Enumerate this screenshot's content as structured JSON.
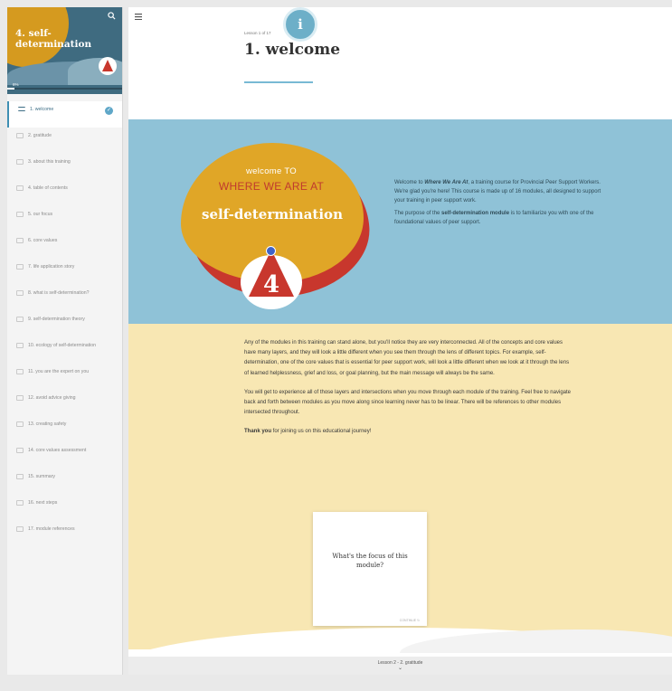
{
  "sidebar": {
    "course_title_line1": "4. self-",
    "course_title_line2": "determination",
    "progress_text": "6%",
    "progress_fraction": 0.06,
    "items": [
      {
        "label": "1. welcome",
        "active": true,
        "completed": true
      },
      {
        "label": "2. gratitude"
      },
      {
        "label": "3. about this training"
      },
      {
        "label": "4. table of contents"
      },
      {
        "label": "5. our focus"
      },
      {
        "label": "6. core values"
      },
      {
        "label": "7. life application story"
      },
      {
        "label": "8. what is self-determination?"
      },
      {
        "label": "9. self-determination theory"
      },
      {
        "label": "10. ecology of self-determination"
      },
      {
        "label": "11. you are the expert on you"
      },
      {
        "label": "12. avoid advice giving"
      },
      {
        "label": "13. creating safety"
      },
      {
        "label": "14. core values assessment"
      },
      {
        "label": "15. summary"
      },
      {
        "label": "16. next steps"
      },
      {
        "label": "17. module references"
      }
    ]
  },
  "header": {
    "lesson_count": "Lesson 1 of 17",
    "title": "1. welcome",
    "info_badge": "i"
  },
  "banner": {
    "welcome_to": "welcome TO",
    "where": "WHERE WE ARE AT",
    "module_name": "self-determination",
    "emblem_number": "4",
    "para1_prefix": "Welcome to ",
    "para1_em": "Where We Are At",
    "para1_suffix": ", a training course for Provincial Peer Support Workers. We're glad you're here! This course is made up of 16 modules, all designed to support your training in peer support work.",
    "para2_prefix": "The purpose of the ",
    "para2_bold": "self-determination module",
    "para2_suffix": " is to familiarize you with one of the foundational values of peer support."
  },
  "body": {
    "para1": "Any of the modules in this training can stand alone, but you'll notice they are very interconnected. All of the concepts and core values have many layers, and they will look a little different when you see them through the lens of different topics. For example, self-determination, one of the core values that is essential for peer support work, will look a little different when we look at it through the lens of learned helplessness, grief and loss, or goal planning, but the main message will always be the same.",
    "para2": "You will get to experience all of those layers and intersections when you move through each module of the training. Feel free to navigate back and forth between modules as you move along since learning never has to be linear. There will be references to other modules intersected throughout.",
    "para3_bold": "Thank you",
    "para3_rest": " for joining us on this educational journey!"
  },
  "card": {
    "question": "What's the focus of this module?",
    "footer": "CONTINUE"
  },
  "footer": {
    "next_lesson": "Lesson 2 - 2. gratitude"
  },
  "colors": {
    "banner_blue": "#8fc2d7",
    "cream": "#f8e7b3",
    "brand_yellow": "#e0a627",
    "brand_red": "#c8372d",
    "accent": "#5fa7c8"
  },
  "icons": {
    "search": "search-icon",
    "hamburger": "hamburger-icon",
    "info": "info-icon",
    "check": "check-icon",
    "chevron": "chevron-down-icon"
  }
}
